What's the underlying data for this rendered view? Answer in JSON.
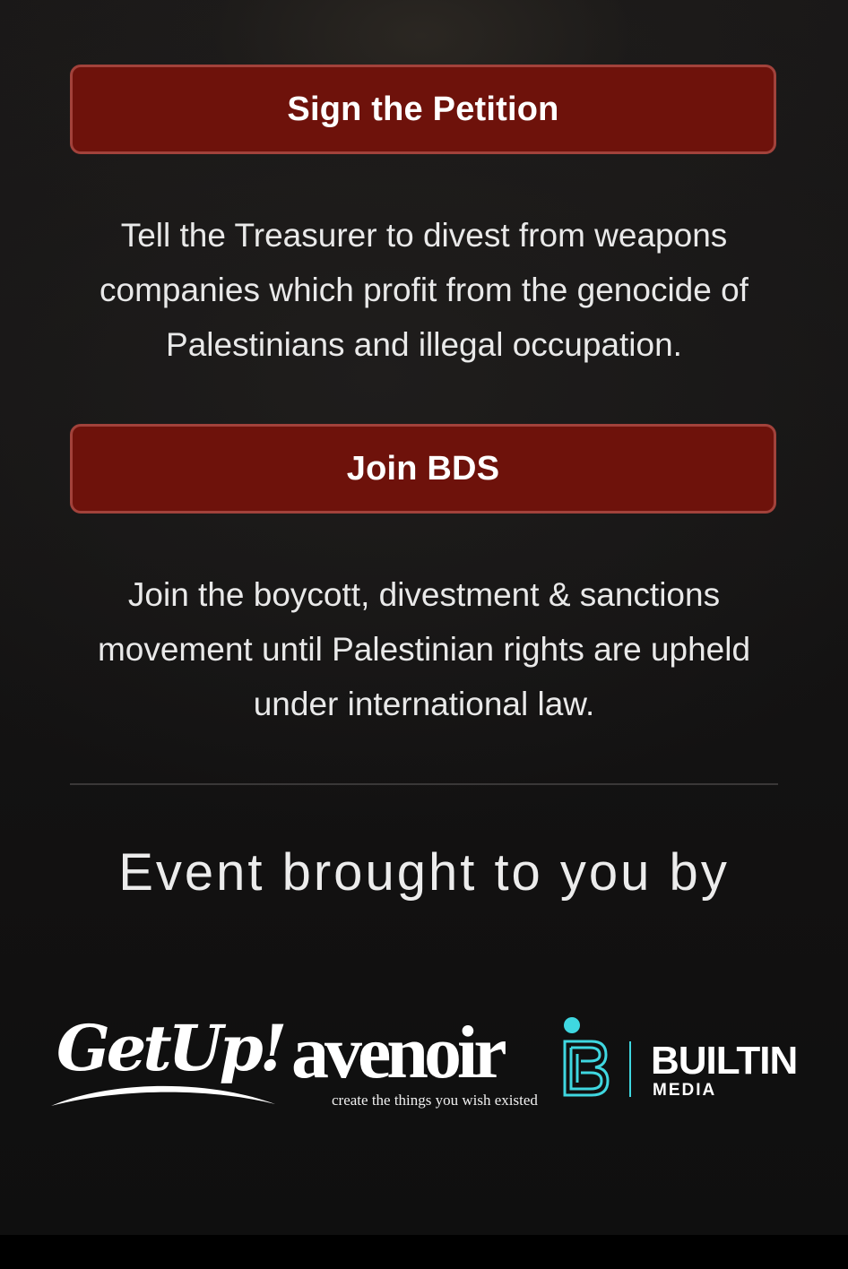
{
  "actions": [
    {
      "button_label": "Sign the Petition",
      "description": "Tell the Treasurer to divest from weapons companies which profit from the genocide of Palestinians and illegal occupation."
    },
    {
      "button_label": "Join BDS",
      "description": "Join the boycott, divestment & sanctions movement until Palestinian rights are upheld under international law."
    }
  ],
  "sponsors": {
    "heading": "Event brought to you by",
    "logos": [
      {
        "name": "GetUp!",
        "icon": "getup-logo"
      },
      {
        "name": "avenoir",
        "tagline": "create the things you wish existed",
        "icon": "avenoir-logo"
      },
      {
        "name": "BUILTIN",
        "sub": "MEDIA",
        "icon": "builtin-media-logo",
        "accent": "#3fd7e0"
      }
    ]
  },
  "colors": {
    "button_bg": "#6e120b",
    "button_border": "#a2423b",
    "background": "#141313",
    "text": "#e9e9e9"
  }
}
